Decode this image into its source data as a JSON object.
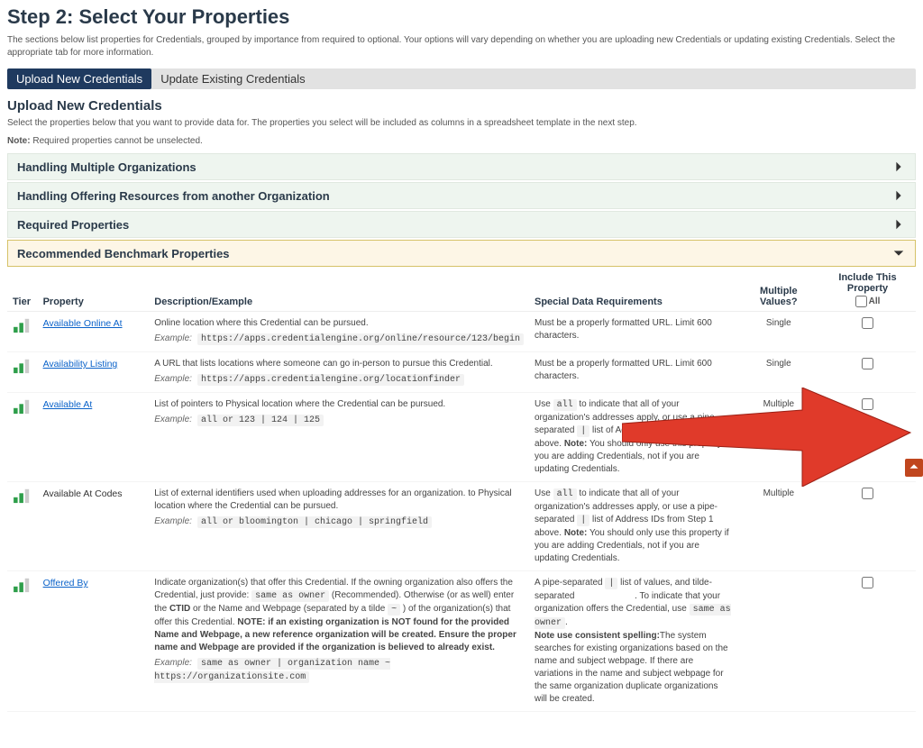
{
  "header": {
    "title": "Step 2: Select Your Properties",
    "intro": "The sections below list properties for Credentials, grouped by importance from required to optional. Your options will vary depending on whether you are uploading new Credentials or updating existing Credentials. Select the appropriate tab for more information."
  },
  "tabs": {
    "upload_new": "Upload New Credentials",
    "update_existing": "Update Existing Credentials"
  },
  "section": {
    "heading": "Upload New Credentials",
    "text": "Select the properties below that you want to provide data for. The properties you select will be included as columns in a spreadsheet template in the next step.",
    "note_label": "Note:",
    "note_text": " Required properties cannot be unselected."
  },
  "accordions": {
    "multi_org": "Handling Multiple Organizations",
    "offering": "Handling Offering Resources from another Organization",
    "required": "Required Properties",
    "benchmark": "Recommended Benchmark Properties"
  },
  "table": {
    "headers": {
      "tier": "Tier",
      "property": "Property",
      "description": "Description/Example",
      "special": "Special Data Requirements",
      "multiple": "Multiple Values?",
      "include": "Include This Property",
      "all": "All"
    },
    "rows": [
      {
        "property": "Available Online At",
        "is_link": true,
        "desc": "Online location where this Credential can be pursued.",
        "example": "https://apps.credentialengine.org/online/resource/123/begin",
        "special": "Must be a properly formatted URL. Limit 600 characters.",
        "multiple": "Single"
      },
      {
        "property": "Availability Listing",
        "is_link": true,
        "desc": "A URL that lists locations where someone can go in-person to pursue this Credential.",
        "example": "https://apps.credentialengine.org/locationfinder",
        "special": "Must be a properly formatted URL. Limit 600 characters.",
        "multiple": "Single"
      },
      {
        "property": "Available At",
        "is_link": true,
        "desc": "List of pointers to Physical location where the Credential can be pursued.",
        "example": "all or 123 | 124 | 125",
        "special_html": "Use <span class='example-code'>all</span> to indicate that all of your organization's addresses apply, or use a pipe-separated <span class='example-code'>|</span> list of Address IDs from Step 1 above. <b>Note:</b> You should only use this property if you are adding Credentials, not if you are updating Credentials.",
        "multiple": "Multiple"
      },
      {
        "property": "Available At Codes",
        "is_link": false,
        "desc": "List of external identifiers used when uploading addresses for an organization. to Physical location where the Credential can be pursued.",
        "example": "all or bloomington | chicago | springfield",
        "special_html": "Use <span class='example-code'>all</span> to indicate that all of your organization's addresses apply, or use a pipe-separated <span class='example-code'>|</span> list of Address IDs from Step 1 above. <b>Note:</b> You should only use this property if you are adding Credentials, not if you are updating Credentials.",
        "multiple": "Multiple"
      },
      {
        "property": "Offered By",
        "is_link": true,
        "desc_html": "Indicate organization(s) that offer this Credential. If the owning organization also offers the Credential, just provide: <span class='example-code'>same as owner</span> (Recommended). Otherwise (or as well) enter the <b>CTID</b> or the Name and Webpage (separated by a tilde <span class='example-code'>~</span> ) of the organization(s) that offer this Credential. <b>NOTE: if an existing organization is NOT found for the provided Name and Webpage, a new reference organization will be created. Ensure the proper name and Webpage are provided if the organization is believed to already exist.</b>",
        "example": "same as owner | organization name ~ https://organizationsite.com",
        "special_html": "A pipe-separated <span class='example-code'>|</span> list of values, and tilde-separated &nbsp;&nbsp;&nbsp;&nbsp;&nbsp;&nbsp;&nbsp;&nbsp;&nbsp;&nbsp;&nbsp;&nbsp;&nbsp;&nbsp;&nbsp;&nbsp;&nbsp;&nbsp;&nbsp;&nbsp;&nbsp;&nbsp;&nbsp;. To indicate that your organization offers the Credential, use <span class='example-code'>same as owner</span>.<br><b>Note use consistent spelling:</b>The system searches for existing organizations based on the name and subject webpage. If there are variations in the name and subject webpage for the same organization duplicate organizations will be created.",
        "multiple": ""
      }
    ]
  }
}
